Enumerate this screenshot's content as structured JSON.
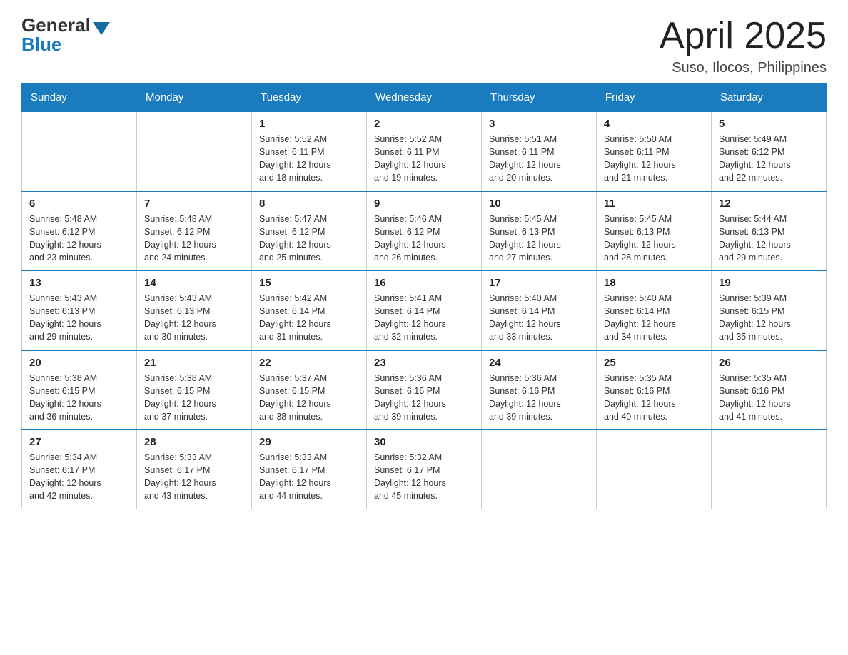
{
  "logo": {
    "general": "General",
    "blue": "Blue"
  },
  "title": {
    "month_year": "April 2025",
    "location": "Suso, Ilocos, Philippines"
  },
  "weekdays": [
    "Sunday",
    "Monday",
    "Tuesday",
    "Wednesday",
    "Thursday",
    "Friday",
    "Saturday"
  ],
  "weeks": [
    [
      {
        "day": "",
        "info": ""
      },
      {
        "day": "",
        "info": ""
      },
      {
        "day": "1",
        "info": "Sunrise: 5:52 AM\nSunset: 6:11 PM\nDaylight: 12 hours\nand 18 minutes."
      },
      {
        "day": "2",
        "info": "Sunrise: 5:52 AM\nSunset: 6:11 PM\nDaylight: 12 hours\nand 19 minutes."
      },
      {
        "day": "3",
        "info": "Sunrise: 5:51 AM\nSunset: 6:11 PM\nDaylight: 12 hours\nand 20 minutes."
      },
      {
        "day": "4",
        "info": "Sunrise: 5:50 AM\nSunset: 6:11 PM\nDaylight: 12 hours\nand 21 minutes."
      },
      {
        "day": "5",
        "info": "Sunrise: 5:49 AM\nSunset: 6:12 PM\nDaylight: 12 hours\nand 22 minutes."
      }
    ],
    [
      {
        "day": "6",
        "info": "Sunrise: 5:48 AM\nSunset: 6:12 PM\nDaylight: 12 hours\nand 23 minutes."
      },
      {
        "day": "7",
        "info": "Sunrise: 5:48 AM\nSunset: 6:12 PM\nDaylight: 12 hours\nand 24 minutes."
      },
      {
        "day": "8",
        "info": "Sunrise: 5:47 AM\nSunset: 6:12 PM\nDaylight: 12 hours\nand 25 minutes."
      },
      {
        "day": "9",
        "info": "Sunrise: 5:46 AM\nSunset: 6:12 PM\nDaylight: 12 hours\nand 26 minutes."
      },
      {
        "day": "10",
        "info": "Sunrise: 5:45 AM\nSunset: 6:13 PM\nDaylight: 12 hours\nand 27 minutes."
      },
      {
        "day": "11",
        "info": "Sunrise: 5:45 AM\nSunset: 6:13 PM\nDaylight: 12 hours\nand 28 minutes."
      },
      {
        "day": "12",
        "info": "Sunrise: 5:44 AM\nSunset: 6:13 PM\nDaylight: 12 hours\nand 29 minutes."
      }
    ],
    [
      {
        "day": "13",
        "info": "Sunrise: 5:43 AM\nSunset: 6:13 PM\nDaylight: 12 hours\nand 29 minutes."
      },
      {
        "day": "14",
        "info": "Sunrise: 5:43 AM\nSunset: 6:13 PM\nDaylight: 12 hours\nand 30 minutes."
      },
      {
        "day": "15",
        "info": "Sunrise: 5:42 AM\nSunset: 6:14 PM\nDaylight: 12 hours\nand 31 minutes."
      },
      {
        "day": "16",
        "info": "Sunrise: 5:41 AM\nSunset: 6:14 PM\nDaylight: 12 hours\nand 32 minutes."
      },
      {
        "day": "17",
        "info": "Sunrise: 5:40 AM\nSunset: 6:14 PM\nDaylight: 12 hours\nand 33 minutes."
      },
      {
        "day": "18",
        "info": "Sunrise: 5:40 AM\nSunset: 6:14 PM\nDaylight: 12 hours\nand 34 minutes."
      },
      {
        "day": "19",
        "info": "Sunrise: 5:39 AM\nSunset: 6:15 PM\nDaylight: 12 hours\nand 35 minutes."
      }
    ],
    [
      {
        "day": "20",
        "info": "Sunrise: 5:38 AM\nSunset: 6:15 PM\nDaylight: 12 hours\nand 36 minutes."
      },
      {
        "day": "21",
        "info": "Sunrise: 5:38 AM\nSunset: 6:15 PM\nDaylight: 12 hours\nand 37 minutes."
      },
      {
        "day": "22",
        "info": "Sunrise: 5:37 AM\nSunset: 6:15 PM\nDaylight: 12 hours\nand 38 minutes."
      },
      {
        "day": "23",
        "info": "Sunrise: 5:36 AM\nSunset: 6:16 PM\nDaylight: 12 hours\nand 39 minutes."
      },
      {
        "day": "24",
        "info": "Sunrise: 5:36 AM\nSunset: 6:16 PM\nDaylight: 12 hours\nand 39 minutes."
      },
      {
        "day": "25",
        "info": "Sunrise: 5:35 AM\nSunset: 6:16 PM\nDaylight: 12 hours\nand 40 minutes."
      },
      {
        "day": "26",
        "info": "Sunrise: 5:35 AM\nSunset: 6:16 PM\nDaylight: 12 hours\nand 41 minutes."
      }
    ],
    [
      {
        "day": "27",
        "info": "Sunrise: 5:34 AM\nSunset: 6:17 PM\nDaylight: 12 hours\nand 42 minutes."
      },
      {
        "day": "28",
        "info": "Sunrise: 5:33 AM\nSunset: 6:17 PM\nDaylight: 12 hours\nand 43 minutes."
      },
      {
        "day": "29",
        "info": "Sunrise: 5:33 AM\nSunset: 6:17 PM\nDaylight: 12 hours\nand 44 minutes."
      },
      {
        "day": "30",
        "info": "Sunrise: 5:32 AM\nSunset: 6:17 PM\nDaylight: 12 hours\nand 45 minutes."
      },
      {
        "day": "",
        "info": ""
      },
      {
        "day": "",
        "info": ""
      },
      {
        "day": "",
        "info": ""
      }
    ]
  ]
}
